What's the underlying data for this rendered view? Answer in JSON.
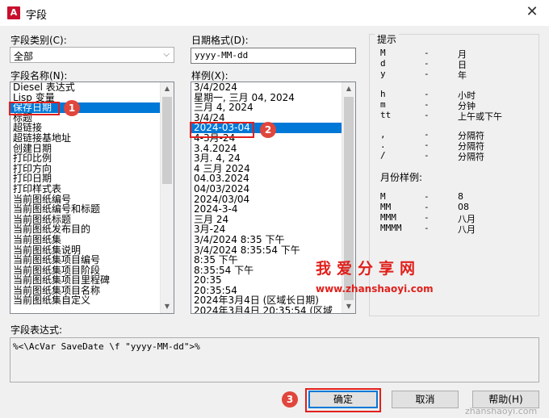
{
  "window": {
    "title": "字段",
    "app_icon_text": "A"
  },
  "field_category": {
    "label": "字段类别(C):",
    "selected": "全部"
  },
  "field_names": {
    "label": "字段名称(N):",
    "items": [
      "Diesel 表达式",
      "Lisp 变量",
      "保存日期",
      "标题",
      "超链接",
      "超链接基地址",
      "创建日期",
      "打印比例",
      "打印方向",
      "打印日期",
      "打印样式表",
      "当前图纸编号",
      "当前图纸编号和标题",
      "当前图纸标题",
      "当前图纸发布目的",
      "当前图纸集",
      "当前图纸集说明",
      "当前图纸集项目编号",
      "当前图纸集项目阶段",
      "当前图纸集项目里程碑",
      "当前图纸集项目名称",
      "当前图纸集自定义"
    ],
    "selected_index": 2
  },
  "date_format": {
    "label": "日期格式(D):",
    "value": "yyyy-MM-dd"
  },
  "examples": {
    "label": "样例(X):",
    "items": [
      "3/4/2024",
      "星期一, 三月 04, 2024",
      "三月 4, 2024",
      "3/4/24",
      "2024-03-04",
      "4-3月-24",
      "3.4.2024",
      "3月. 4, 24",
      "4 三月 2024",
      "04.03.2024",
      "04/03/2024",
      "2024/03/04",
      "2024-3-4",
      "三月 24",
      "3月-24",
      "3/4/2024 8:35 下午",
      "3/4/2024 8:35:54 下午",
      "8:35 下午",
      "8:35:54 下午",
      "20:35",
      "20:35:54",
      "2024年3月4日 (区域长日期)",
      "2024年3月4日 20:35:54 (区域"
    ],
    "selected_index": 4
  },
  "hints": {
    "title": "提示",
    "rows": [
      {
        "code": "M",
        "dash": "-",
        "desc": "月"
      },
      {
        "code": "d",
        "dash": "-",
        "desc": "日"
      },
      {
        "code": "y",
        "dash": "-",
        "desc": "年"
      },
      {
        "code": "h",
        "dash": "-",
        "desc": "小时"
      },
      {
        "code": "m",
        "dash": "-",
        "desc": "分钟"
      },
      {
        "code": "tt",
        "dash": "-",
        "desc": "上午或下午"
      },
      {
        "code": ",",
        "dash": "-",
        "desc": "分隔符"
      },
      {
        "code": ".",
        "dash": "-",
        "desc": "分隔符"
      },
      {
        "code": "/",
        "dash": "-",
        "desc": "分隔符"
      }
    ],
    "month_title": "月份样例:",
    "month_rows": [
      {
        "code": "M",
        "dash": "-",
        "desc": "8"
      },
      {
        "code": "MM",
        "dash": "-",
        "desc": "08"
      },
      {
        "code": "MMM",
        "dash": "-",
        "desc": "八月"
      },
      {
        "code": "MMMM",
        "dash": "-",
        "desc": "八月"
      }
    ]
  },
  "expression": {
    "label": "字段表达式:",
    "value": "%<\\AcVar SaveDate \\f \"yyyy-MM-dd\">%"
  },
  "buttons": {
    "ok": "确定",
    "cancel": "取消",
    "help": "帮助(H)"
  },
  "markers": {
    "one": "1",
    "two": "2",
    "three": "3"
  },
  "watermark": {
    "title": "我爱分享网",
    "url": "www.zhanshaoyi.com",
    "corner": "zhanshaoyi.com"
  },
  "colors": {
    "selection": "#0078d7",
    "marker": "#e0463c",
    "watermark": "#e0201c"
  }
}
